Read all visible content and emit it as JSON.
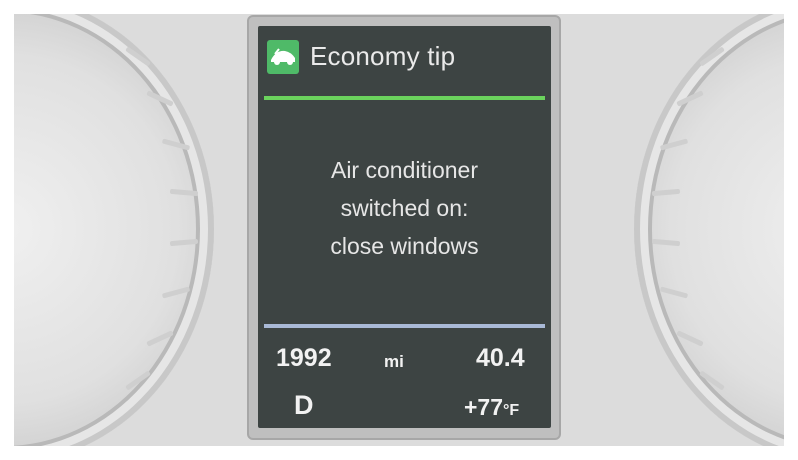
{
  "header": {
    "title": "Economy tip",
    "icon": "car-icon"
  },
  "message": {
    "lines": [
      "Air conditioner",
      "switched on:",
      "close windows"
    ]
  },
  "trip": {
    "odometer": "1992",
    "unit": "mi",
    "average": "40.4",
    "gear": "D",
    "temperature": "+77",
    "temp_unit": "°F"
  },
  "colors": {
    "header_line": "#6bd35d",
    "info_line": "#a9b9d6",
    "icon_bg": "#4fba68",
    "screen_bg": "#3d4443"
  }
}
